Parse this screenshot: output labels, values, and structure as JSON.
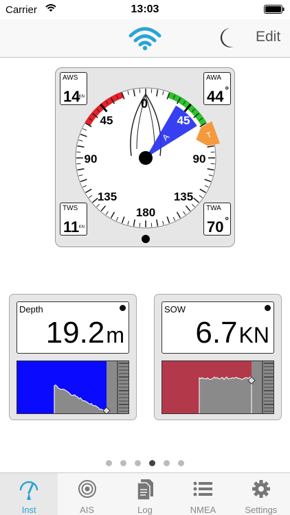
{
  "status": {
    "carrier": "Carrier",
    "time": "13:03"
  },
  "nav": {
    "edit_label": "Edit"
  },
  "wind": {
    "aws": {
      "label": "AWS",
      "value": "14",
      "unit": "KN"
    },
    "awa": {
      "label": "AWA",
      "value": "44",
      "deg": "°"
    },
    "tws": {
      "label": "TWS",
      "value": "11",
      "unit": "KN"
    },
    "twa": {
      "label": "TWA",
      "value": "70",
      "deg": "°"
    },
    "dial_labels": {
      "top": "0",
      "upper_left": "45",
      "upper_right": "45",
      "left": "90",
      "right": "90",
      "lower_left": "135",
      "lower_right": "135",
      "bottom": "180"
    },
    "apparent_marker": "A",
    "true_marker": "T",
    "colors": {
      "port": "#e8202a",
      "starboard": "#2ec22e",
      "apparent": "#2c36f0",
      "true": "#f59a3c"
    }
  },
  "depth": {
    "title": "Depth",
    "value": "19.2",
    "unit": "m",
    "graph_color": "#0a0aff",
    "trend_level": 0.55
  },
  "sow": {
    "title": "SOW",
    "value": "6.7",
    "unit": "KN",
    "graph_color": "#b3394a",
    "trend_level": 0.62
  },
  "pager": {
    "count": 6,
    "active": 3
  },
  "tabs": [
    {
      "label": "Inst",
      "icon": "gauge-icon"
    },
    {
      "label": "AIS",
      "icon": "target-icon"
    },
    {
      "label": "Log",
      "icon": "document-icon"
    },
    {
      "label": "NMEA",
      "icon": "list-icon"
    },
    {
      "label": "Settings",
      "icon": "gear-icon"
    }
  ],
  "accent": "#2aa4d6"
}
